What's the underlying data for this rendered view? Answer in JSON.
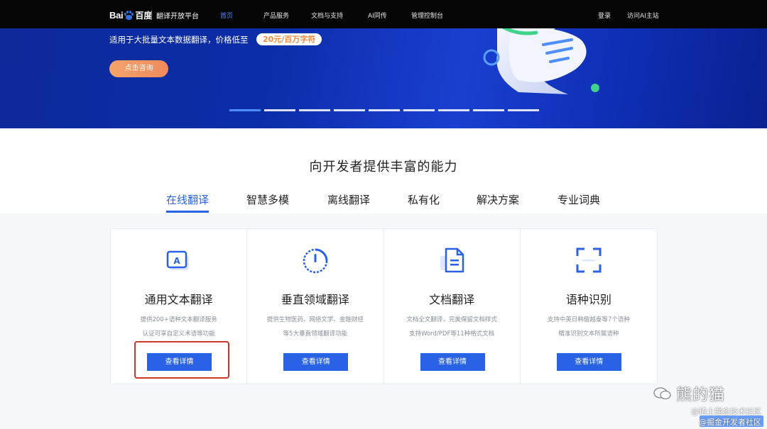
{
  "nav": {
    "logo_text_latin": "Bai",
    "logo_text_cn": "百度",
    "brand": "翻译开放平台",
    "items": [
      {
        "label": "首页",
        "active": true
      },
      {
        "label": "产品服务",
        "active": false
      },
      {
        "label": "文档与支持",
        "active": false
      },
      {
        "label": "AI同传",
        "active": false
      },
      {
        "label": "管理控制台",
        "active": false
      }
    ],
    "login": "登录",
    "visit_ai": "访问AI主站"
  },
  "hero": {
    "subtitle": "适用于大批量文本数据翻译，价格低至",
    "price": "20元/百万字符",
    "consult_button": "点击咨询",
    "carousel_count": 9,
    "carousel_active_index": 0
  },
  "section": {
    "title": "向开发者提供丰富的能力",
    "tabs": [
      {
        "label": "在线翻译",
        "active": true
      },
      {
        "label": "智慧多模",
        "active": false
      },
      {
        "label": "离线翻译",
        "active": false
      },
      {
        "label": "私有化",
        "active": false
      },
      {
        "label": "解决方案",
        "active": false
      },
      {
        "label": "专业词典",
        "active": false
      }
    ]
  },
  "cards": [
    {
      "icon": "text-translate-icon",
      "title": "通用文本翻译",
      "desc1": "提供200+语种文本翻译服务",
      "desc2": "认证可享自定义术语等功能",
      "button": "查看详情"
    },
    {
      "icon": "vertical-domain-icon",
      "title": "垂直领域翻译",
      "desc1": "提供生物医药、网络文学、金融财经",
      "desc2": "等5大垂直领域翻译功能",
      "button": "查看详情"
    },
    {
      "icon": "document-icon",
      "title": "文档翻译",
      "desc1": "文档全文翻译，完美保留文档样式",
      "desc2": "支持Word/PDF等11种格式文档",
      "button": "查看详情"
    },
    {
      "icon": "scan-frame-icon",
      "title": "语种识别",
      "desc1": "支持中英日韩俄越泰等7个语种",
      "desc2": "精准识别文本所属语种",
      "button": "查看详情"
    }
  ],
  "watermark": {
    "name": "熊的猫",
    "line1": "@稀土掘金技术社区",
    "line2": "@掘金开发者社区"
  },
  "colors": {
    "accent": "#2a62e6",
    "nav_bg": "#050505",
    "highlight": "#d0352c",
    "price_text": "#f08a3c"
  }
}
